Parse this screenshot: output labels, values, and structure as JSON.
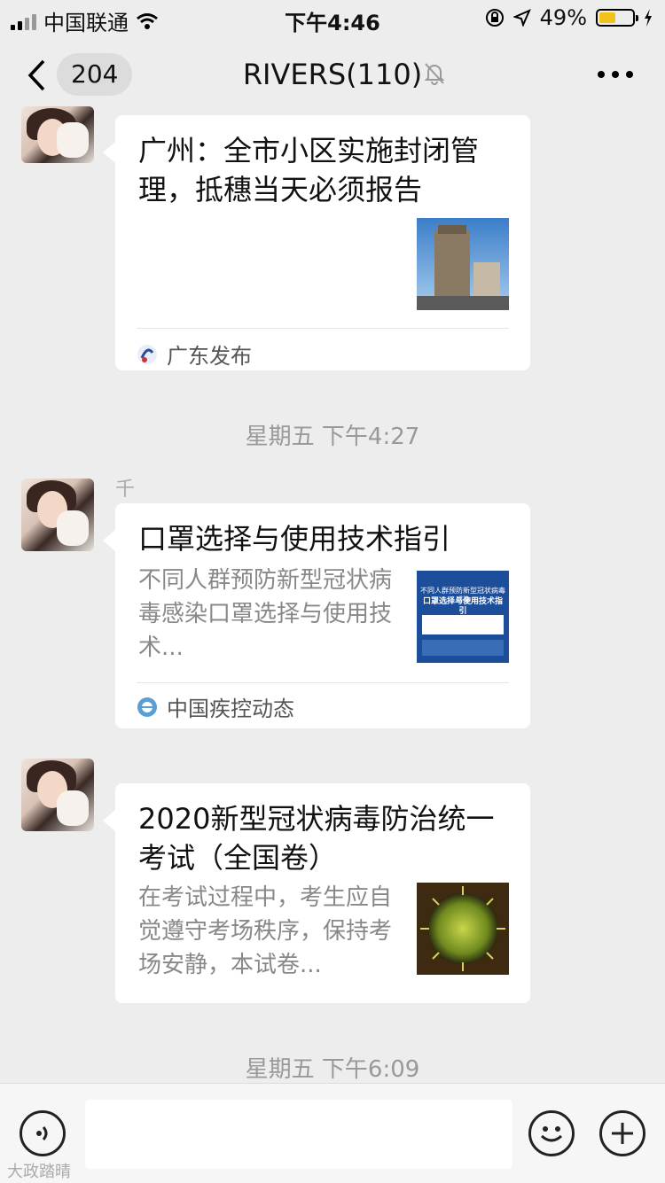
{
  "status_bar": {
    "carrier": "中国联通",
    "time": "下午4:46",
    "battery_percent": "49%",
    "battery_level": 0.49,
    "battery_color": "#f2c21b"
  },
  "nav": {
    "back_count": "204",
    "title": "RIVERS(110)"
  },
  "messages": [
    {
      "title": "广州：全市小区实施封闭管理，抵穗当天必须报告",
      "description": "",
      "source": "广东发布",
      "thumbnail": "building-photo"
    },
    {
      "timestamp": "星期五 下午4:27",
      "sender": "千",
      "title": "口罩选择与使用技术指引",
      "description": "不同人群预防新型冠状病毒感染口罩选择与使用技术...",
      "source": "中国疾控动态",
      "thumbnail_text_1": "不同人群预防新型冠状病毒感染",
      "thumbnail_text_2": "口罩选择与使用技术指引"
    },
    {
      "title": "2020新型冠状病毒防治统一考试（全国卷）",
      "description": "在考试过程中，考生应自觉遵守考场秩序，保持考场安静，本试卷...",
      "thumbnail": "virus-image"
    }
  ],
  "timestamp_bottom": "星期五 下午6:09",
  "input": {
    "placeholder": ""
  },
  "watermark": "大政踏晴",
  "colors": {
    "background": "#ededed",
    "card": "#ffffff",
    "secondary_text": "#888888"
  }
}
